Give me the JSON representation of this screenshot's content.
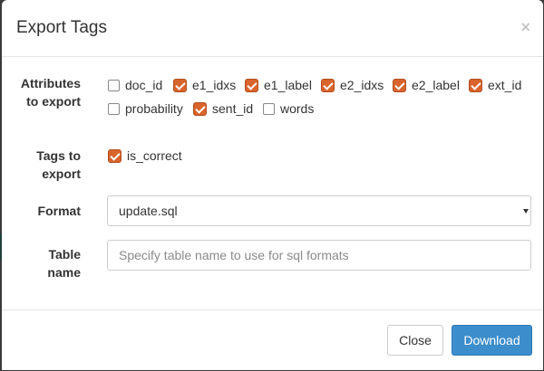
{
  "modal": {
    "title": "Export Tags",
    "close_symbol": "×"
  },
  "attributes": {
    "label_line1": "Attributes",
    "label_line2": "to export",
    "items": [
      {
        "label": "doc_id",
        "checked": false
      },
      {
        "label": "e1_idxs",
        "checked": true
      },
      {
        "label": "e1_label",
        "checked": true
      },
      {
        "label": "e2_idxs",
        "checked": true
      },
      {
        "label": "e2_label",
        "checked": true
      },
      {
        "label": "ext_id",
        "checked": true
      },
      {
        "label": "probability",
        "checked": false
      },
      {
        "label": "sent_id",
        "checked": true
      },
      {
        "label": "words",
        "checked": false
      }
    ]
  },
  "tags": {
    "label_line1": "Tags to",
    "label_line2": "export",
    "items": [
      {
        "label": "is_correct",
        "checked": true
      }
    ]
  },
  "format": {
    "label": "Format",
    "selected": "update.sql"
  },
  "table_name": {
    "label_line1": "Table",
    "label_line2": "name",
    "value": "",
    "placeholder": "Specify table name to use for sql formats"
  },
  "footer": {
    "close_label": "Close",
    "download_label": "Download"
  },
  "colors": {
    "checkbox_checked": "#d9642c",
    "primary_button": "#3c8dcb"
  }
}
